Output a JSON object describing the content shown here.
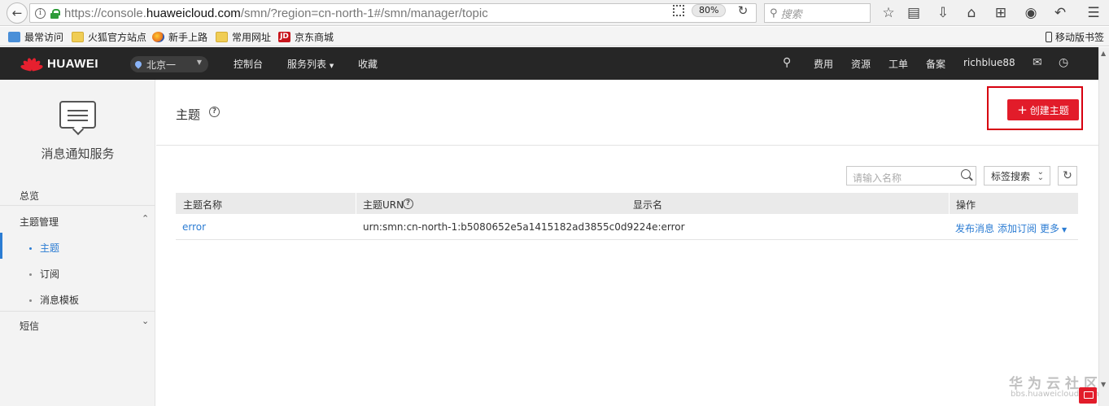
{
  "browser": {
    "url_prefix": "https://console.",
    "url_domain": "huaweicloud.com",
    "url_suffix": "/smn/?region=cn-north-1#/smn/manager/topic",
    "zoom": "80%",
    "search_placeholder": "搜索"
  },
  "bookmarks": {
    "items": [
      {
        "label": "最常访问",
        "icon": "bookmark-blue-icon"
      },
      {
        "label": "火狐官方站点",
        "icon": "folder-icon"
      },
      {
        "label": "新手上路",
        "icon": "firefox-icon"
      },
      {
        "label": "常用网址",
        "icon": "folder-icon"
      },
      {
        "label": "京东商城",
        "icon": "jd-icon"
      }
    ],
    "jd_badge": "JD",
    "mobile": "移动版书签"
  },
  "topnav": {
    "brand": "HUAWEI",
    "region": "北京一",
    "console": "控制台",
    "services": "服务列表",
    "favorites": "收藏",
    "fees": "费用",
    "resources": "资源",
    "tickets": "工单",
    "filing": "备案",
    "username": "richblue88"
  },
  "sidebar": {
    "service_name": "消息通知服务",
    "overview": "总览",
    "topic_mgmt": "主题管理",
    "sub_topic": "主题",
    "sub_subscription": "订阅",
    "sub_template": "消息模板",
    "sms": "短信"
  },
  "main": {
    "title": "主题",
    "create_button": "创建主题",
    "name_search_placeholder": "请输入名称",
    "tag_search": "标签搜索",
    "columns": {
      "topic_name": "主题名称",
      "topic_urn": "主题URN",
      "display_name": "显示名",
      "actions": "操作"
    },
    "rows": [
      {
        "name": "error",
        "urn": "urn:smn:cn-north-1:b5080652e5a1415182ad3855c0d9224e:error",
        "display_name": "",
        "action_publish": "发布消息",
        "action_subscribe": "添加订阅",
        "action_more": "更多"
      }
    ]
  },
  "watermark": {
    "title": "华为云社区",
    "site": "bbs.huaweicloud.com"
  },
  "colors": {
    "accent": "#2b7cd3",
    "brand_red": "#e21c2a",
    "nav_bg": "#262626"
  }
}
